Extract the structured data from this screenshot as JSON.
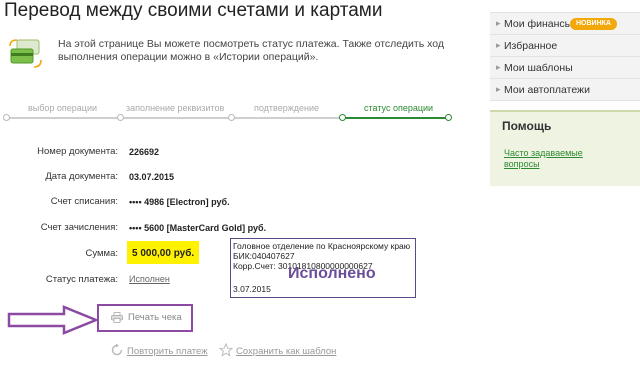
{
  "page": {
    "title": "Перевод между своими счетами и картами",
    "intro": "На этой странице Вы можете посмотреть статус платежа. Также отследить ход выполнения операции можно в «Истории операций»."
  },
  "steps": [
    {
      "label": "выбор операции",
      "active": false
    },
    {
      "label": "заполнение реквизитов",
      "active": false
    },
    {
      "label": "подтверждение",
      "active": false
    },
    {
      "label": "статус операции",
      "active": true
    }
  ],
  "details": {
    "doc_number": {
      "label": "Номер документа:",
      "value": "226692"
    },
    "doc_date": {
      "label": "Дата документа:",
      "value": "03.07.2015"
    },
    "debit_account": {
      "label": "Счет списания:",
      "value": "•••• 4986  [Electron]  руб."
    },
    "credit_account": {
      "label": "Счет зачисления:",
      "value": "•••• 5600  [MasterCard Gold]  руб."
    },
    "amount": {
      "label": "Сумма:",
      "value": "5 000,00  руб."
    },
    "status": {
      "label": "Статус платежа:",
      "value": "Исполнен"
    }
  },
  "stamp": {
    "line1": "Головное отделение по Красноярскому краю",
    "line2": "БИК:040407627",
    "line3": "Корр.Счет: 30101810800000000627",
    "big": "Исполнено",
    "date": "3.07.2015"
  },
  "actions": {
    "print": "Печать чека",
    "repeat": "Повторить платеж",
    "save_template": "Сохранить как шаблон"
  },
  "sidebar": {
    "items": [
      {
        "label": "Мои финансы",
        "badge": "НОВИНКА"
      },
      {
        "label": "Избранное"
      },
      {
        "label": "Мои шаблоны"
      },
      {
        "label": "Мои автоплатежи"
      }
    ],
    "help": {
      "title": "Помощь",
      "link": "Часто задаваемые вопросы"
    }
  },
  "colors": {
    "accent_green": "#2d8a32",
    "highlight_yellow": "#fff200",
    "annotation_purple": "#8c4aa3",
    "badge_orange": "#f3a80a"
  }
}
